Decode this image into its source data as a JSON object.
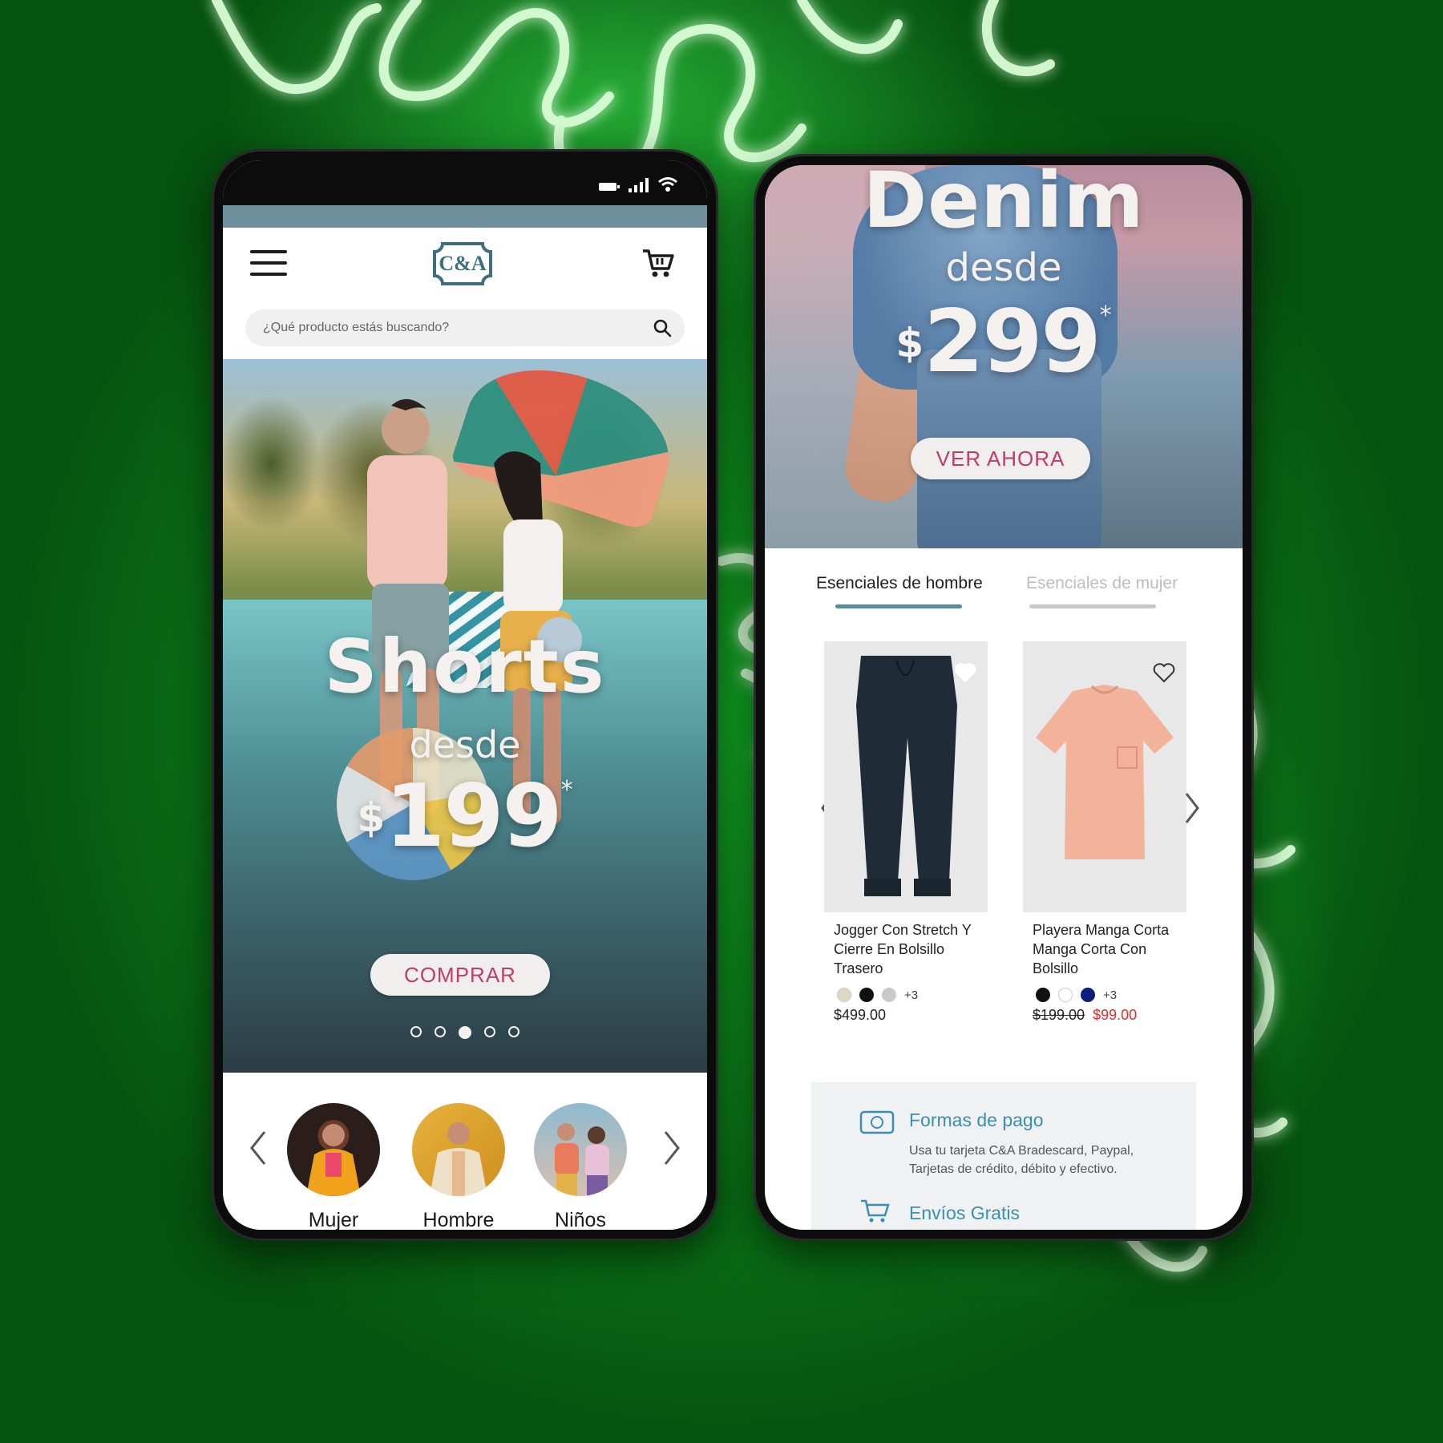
{
  "colors": {
    "background_green": "#0b7d18",
    "neon": "#d9ffd8",
    "header_strip": "#6f8f9c",
    "brand_teal": "#3f6f7f",
    "cta_text": "#c13d64",
    "sale_red": "#e22b2b",
    "info_title": "#3b8fb0",
    "tab_active": "#5d8a9a",
    "tab_inactive": "#c8c8c8"
  },
  "left_phone": {
    "header": {
      "menu_icon": "hamburger-menu-icon",
      "logo_text": "C&A",
      "cart_icon": "shopping-cart-icon"
    },
    "search": {
      "placeholder": "¿Qué producto estás buscando?",
      "icon": "search-icon"
    },
    "hero": {
      "title": "Shorts",
      "subtitle": "desde",
      "currency": "$",
      "price": "199",
      "asterisk": "*",
      "button": "COMPRAR",
      "slides_total": 5,
      "active_slide": 3
    },
    "categories": {
      "prev_icon": "chevron-left-icon",
      "next_icon": "chevron-right-icon",
      "items": [
        {
          "label": "Mujer"
        },
        {
          "label": "Hombre"
        },
        {
          "label": "Niños"
        }
      ]
    }
  },
  "right_phone": {
    "hero": {
      "title": "Denim",
      "subtitle": "desde",
      "currency": "$",
      "price": "299",
      "asterisk": "*",
      "button": "VER AHORA"
    },
    "tabs": [
      {
        "label": "Esenciales de hombre",
        "active": true
      },
      {
        "label": "Esenciales de mujer",
        "active": false
      }
    ],
    "products": [
      {
        "name": "Jogger Con Stretch Y Cierre En Bolsillo Trasero",
        "swatches": [
          "#ddd8c4",
          "#111111",
          "#c9c9c9"
        ],
        "more_colors": "+3",
        "price": "$499.00",
        "favorited": true
      },
      {
        "name": "Playera Manga Corta Manga Corta Con Bolsillo",
        "swatches": [
          "#111111",
          "#ffffff",
          "#0c1f7a"
        ],
        "more_colors": "+3",
        "old_price": "$199.00",
        "sale_price": "$99.00",
        "favorited": false
      }
    ],
    "info": {
      "payment_title": "Formas de pago",
      "payment_text": "Usa tu tarjeta C&A Bradescard, Paypal, Tarjetas de crédito, débito y efectivo.",
      "shipping_title": "Envíos Gratis"
    }
  }
}
